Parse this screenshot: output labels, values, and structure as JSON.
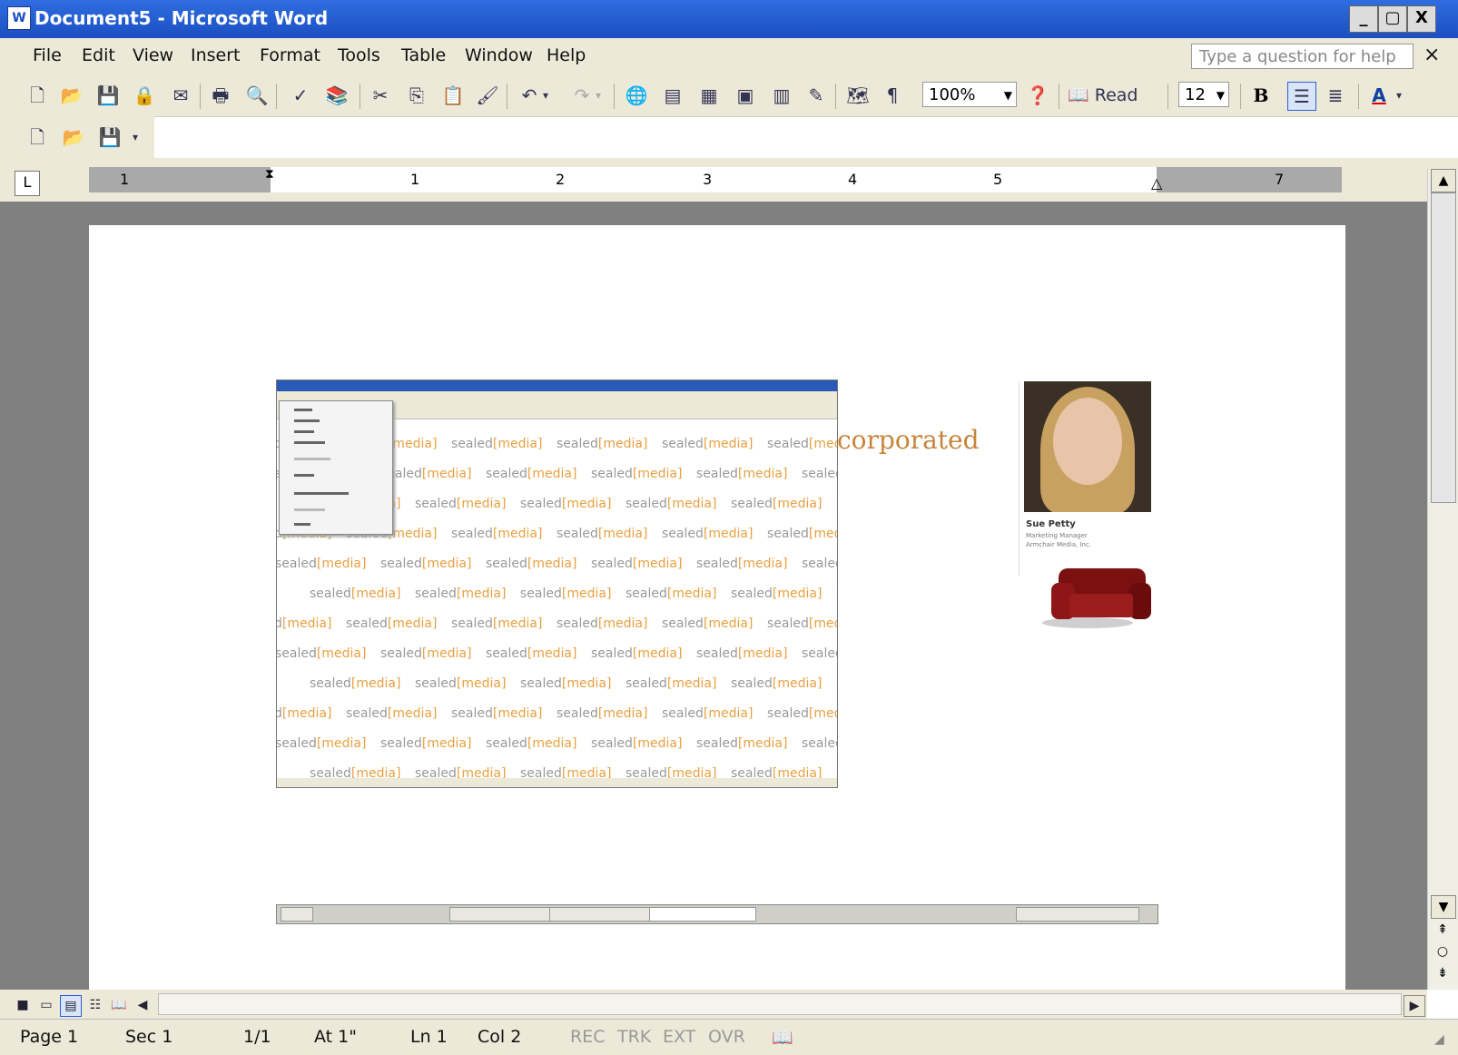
{
  "window": {
    "title": "Document5 - Microsoft Word",
    "buttons": [
      "_",
      "▢",
      "X"
    ]
  },
  "menu": {
    "items": [
      "File",
      "Edit",
      "View",
      "Insert",
      "Format",
      "Tools",
      "Table",
      "Window",
      "Help"
    ],
    "help_placeholder": "Type a question for help",
    "close": "×"
  },
  "toolbar": {
    "zoom": "100%",
    "read_label": "Read",
    "font_size": "12",
    "bold": "B",
    "font_color": "A"
  },
  "ruler": {
    "tab_selector": "L",
    "numbers": [
      "1",
      "1",
      "2",
      "3",
      "4",
      "5",
      "7"
    ]
  },
  "document": {
    "embedded_window": {
      "watermark_word": "sealed",
      "watermark_bracket": "[media]"
    },
    "heading_fragment": "corporated",
    "profile": {
      "name": "Sue Petty",
      "role_line1": "Marketing Manager",
      "role_line2": "Armchair Media, Inc."
    }
  },
  "statusbar": {
    "page": "Page 1",
    "sec": "Sec 1",
    "pages": "1/1",
    "at": "At 1\"",
    "ln": "Ln 1",
    "col": "Col 2",
    "rec": "REC",
    "trk": "TRK",
    "ext": "EXT",
    "ovr": "OVR"
  },
  "colors": {
    "titlebar": "#1b4fc2",
    "chrome": "#ece9d8",
    "workspace": "#808080",
    "accent_orange": "#c8843c"
  }
}
